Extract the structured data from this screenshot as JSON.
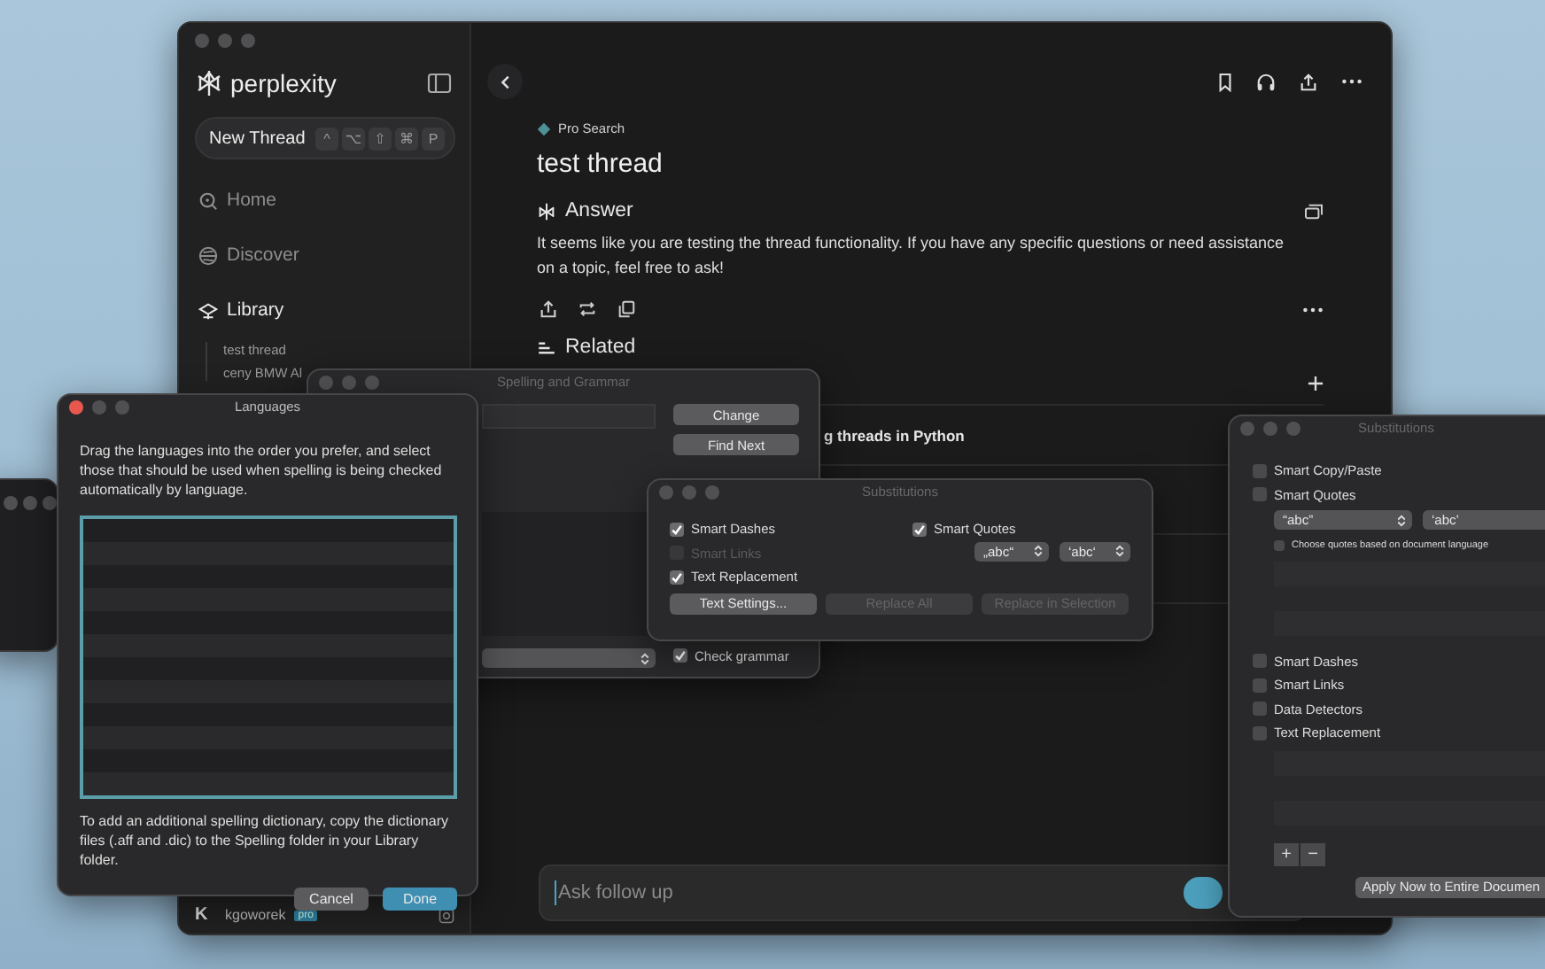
{
  "main_window": {
    "sidebar": {
      "logo": "perplexity",
      "new_thread": {
        "label": "New Thread",
        "keys": [
          "^",
          "⌥",
          "⇧",
          "⌘",
          "P"
        ]
      },
      "nav": [
        {
          "label": "Home",
          "selected": false
        },
        {
          "label": "Discover",
          "selected": false
        },
        {
          "label": "Library",
          "selected": true
        }
      ],
      "library_items": [
        "test thread",
        "ceny BMW Al"
      ],
      "user": {
        "initial": "K",
        "name": "kgoworek",
        "badge": "pro"
      }
    },
    "thread": {
      "mode": "Pro Search",
      "title": "test thread",
      "answer_heading": "Answer",
      "answer": "It seems like you are testing the thread functionality. If you have any specific questions or need assistance on a topic, feel free to ask!",
      "related_heading": "Related",
      "related_items": [
        "g threads in Python"
      ],
      "input_placeholder": "Ask follow up"
    }
  },
  "spelling_window": {
    "title": "Spelling and Grammar",
    "buttons": [
      "Change",
      "Find Next"
    ],
    "check_grammar": {
      "label": "Check grammar",
      "checked": true
    }
  },
  "languages_window": {
    "title": "Languages",
    "intro": "Drag the languages into the order you prefer, and select those that should be used when spelling is being checked automatically by language.",
    "note": "To add an additional spelling dictionary, copy the dictionary files (.aff and .dic) to the Spelling folder in your Library folder.",
    "buttons": [
      {
        "label": "Cancel",
        "default": false
      },
      {
        "label": "Done",
        "default": true
      }
    ]
  },
  "substitutions_window": {
    "title": "Substitutions",
    "options": [
      {
        "label": "Smart Dashes",
        "checked": true,
        "disabled": false
      },
      {
        "label": "Smart Links",
        "checked": false,
        "disabled": true
      },
      {
        "label": "Text Replacement",
        "checked": true,
        "disabled": false
      }
    ],
    "smart_quotes": {
      "label": "Smart Quotes",
      "checked": true
    },
    "quote_styles": [
      "„abc“",
      "‘abc‘"
    ],
    "buttons": [
      {
        "label": "Text Settings...",
        "disabled": false
      },
      {
        "label": "Replace All",
        "disabled": true
      },
      {
        "label": "Replace in Selection",
        "disabled": true
      }
    ]
  },
  "substitutions_panel": {
    "title": "Substitutions",
    "top_options": [
      {
        "label": "Smart Copy/Paste",
        "checked": false
      },
      {
        "label": "Smart Quotes",
        "checked": false
      }
    ],
    "quote_styles": [
      "“abc”",
      "‘abc’"
    ],
    "language_quotes": {
      "label": "Choose quotes based on document language",
      "checked": false
    },
    "options": [
      {
        "label": "Smart Dashes",
        "checked": false
      },
      {
        "label": "Smart Links",
        "checked": false
      },
      {
        "label": "Data Detectors",
        "checked": false
      },
      {
        "label": "Text Replacement",
        "checked": false
      }
    ],
    "add": "+",
    "remove": "−",
    "apply_button": "Apply Now to Entire Documen"
  }
}
